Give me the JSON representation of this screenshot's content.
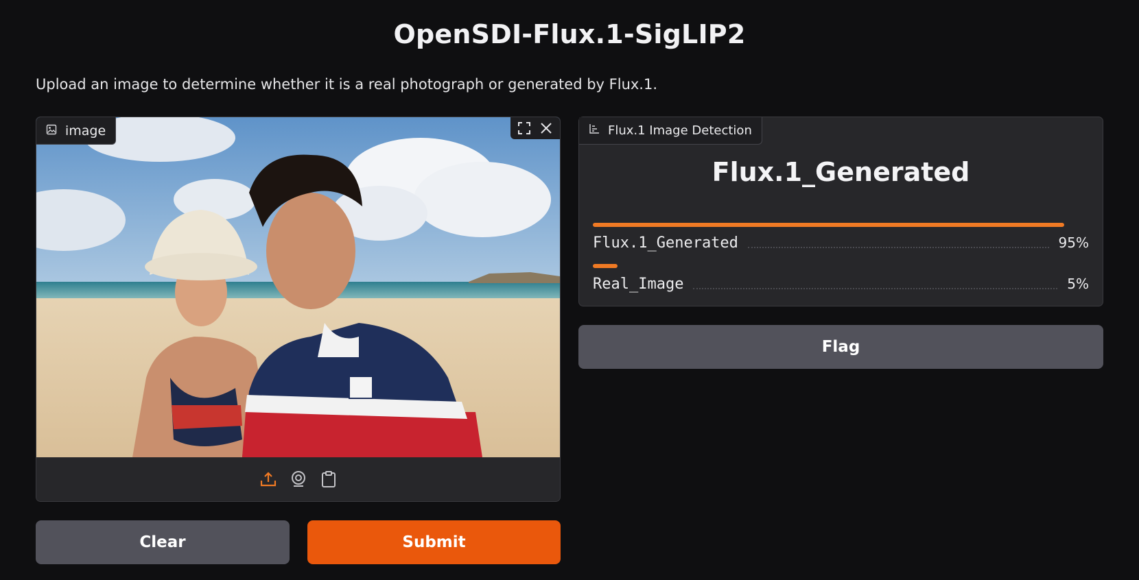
{
  "app": {
    "title": "OpenSDI-Flux.1-SigLIP2",
    "description": "Upload an image to determine whether it is a real photograph or generated by Flux.1."
  },
  "image_input": {
    "label": "image",
    "label_icon": "image-icon",
    "tools": [
      "fullscreen-icon",
      "close-icon"
    ],
    "sources": [
      {
        "name": "upload-icon",
        "active": true
      },
      {
        "name": "webcam-icon",
        "active": false
      },
      {
        "name": "clipboard-icon",
        "active": false
      }
    ]
  },
  "result": {
    "label": "Flux.1 Image Detection",
    "label_icon": "bar-chart-icon",
    "top_label": "Flux.1_Generated",
    "confidences": [
      {
        "label": "Flux.1_Generated",
        "value_text": "95%",
        "fraction": 0.95
      },
      {
        "label": "Real_Image",
        "value_text": "5%",
        "fraction": 0.05
      }
    ]
  },
  "buttons": {
    "flag": "Flag",
    "clear": "Clear",
    "submit": "Submit"
  },
  "colors": {
    "accent": "#ea580c",
    "bar": "#f07a24",
    "secondary_button": "#52525b",
    "background": "#0f0f11",
    "panel": "#27272a"
  }
}
